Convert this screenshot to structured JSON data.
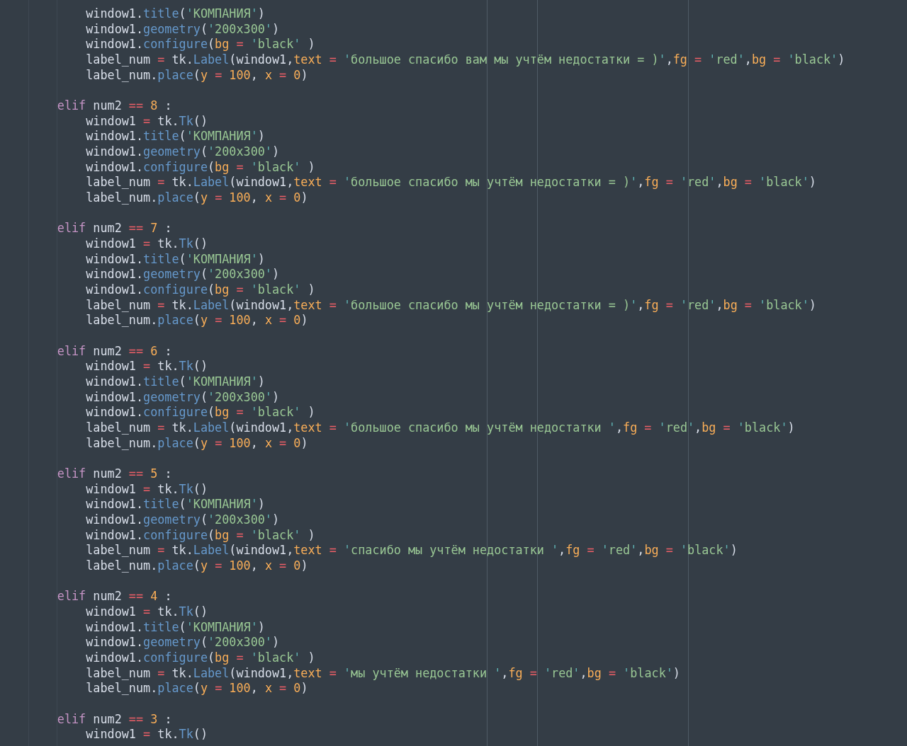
{
  "editor": {
    "blocks": [
      {
        "body": [
          [
            {
              "text": "window1.",
              "kind": "plain"
            },
            {
              "text": "title",
              "kind": "method"
            },
            {
              "text": "(",
              "kind": "plain"
            },
            {
              "text": "'КОМПАНИЯ'",
              "kind": "string"
            },
            {
              "text": ")",
              "kind": "plain"
            }
          ],
          [
            {
              "text": "window1.",
              "kind": "plain"
            },
            {
              "text": "geometry",
              "kind": "method"
            },
            {
              "text": "(",
              "kind": "plain"
            },
            {
              "text": "'200x300'",
              "kind": "string"
            },
            {
              "text": ")",
              "kind": "plain"
            }
          ],
          [
            {
              "text": "window1.",
              "kind": "plain"
            },
            {
              "text": "configure",
              "kind": "method"
            },
            {
              "text": "(",
              "kind": "plain"
            },
            {
              "text": "bg",
              "kind": "param"
            },
            {
              "text": " = ",
              "kind": "op"
            },
            {
              "text": "'black'",
              "kind": "string"
            },
            {
              "text": " )",
              "kind": "plain"
            }
          ],
          [
            {
              "text": "label_num",
              "kind": "plain"
            },
            {
              "text": " = ",
              "kind": "op"
            },
            {
              "text": "tk.",
              "kind": "plain"
            },
            {
              "text": "Label",
              "kind": "method"
            },
            {
              "text": "(window1,",
              "kind": "plain"
            },
            {
              "text": "text",
              "kind": "param"
            },
            {
              "text": " = ",
              "kind": "op"
            },
            {
              "text": "'большое спасибо вам мы учтём недостатки = )'",
              "kind": "string"
            },
            {
              "text": ",",
              "kind": "plain"
            },
            {
              "text": "fg",
              "kind": "param"
            },
            {
              "text": " = ",
              "kind": "op"
            },
            {
              "text": "'red'",
              "kind": "string"
            },
            {
              "text": ",",
              "kind": "plain"
            },
            {
              "text": "bg",
              "kind": "param"
            },
            {
              "text": " = ",
              "kind": "op"
            },
            {
              "text": "'black'",
              "kind": "string"
            },
            {
              "text": ")",
              "kind": "plain"
            }
          ],
          [
            {
              "text": "label_num.",
              "kind": "plain"
            },
            {
              "text": "place",
              "kind": "method"
            },
            {
              "text": "(",
              "kind": "plain"
            },
            {
              "text": "y",
              "kind": "param"
            },
            {
              "text": " = ",
              "kind": "op"
            },
            {
              "text": "100",
              "kind": "number"
            },
            {
              "text": ", ",
              "kind": "plain"
            },
            {
              "text": "x",
              "kind": "param"
            },
            {
              "text": " = ",
              "kind": "op"
            },
            {
              "text": "0",
              "kind": "number"
            },
            {
              "text": ")",
              "kind": "plain"
            }
          ]
        ]
      },
      {
        "header": [
          {
            "text": "elif",
            "kind": "keyword"
          },
          {
            "text": " num2 ",
            "kind": "plain"
          },
          {
            "text": "==",
            "kind": "op"
          },
          {
            "text": " 8",
            "kind": "number"
          },
          {
            "text": " :",
            "kind": "plain"
          }
        ],
        "body": [
          [
            {
              "text": "window1",
              "kind": "plain"
            },
            {
              "text": " = ",
              "kind": "op"
            },
            {
              "text": "tk.",
              "kind": "plain"
            },
            {
              "text": "Tk",
              "kind": "method"
            },
            {
              "text": "()",
              "kind": "plain"
            }
          ],
          [
            {
              "text": "window1.",
              "kind": "plain"
            },
            {
              "text": "title",
              "kind": "method"
            },
            {
              "text": "(",
              "kind": "plain"
            },
            {
              "text": "'КОМПАНИЯ'",
              "kind": "string"
            },
            {
              "text": ")",
              "kind": "plain"
            }
          ],
          [
            {
              "text": "window1.",
              "kind": "plain"
            },
            {
              "text": "geometry",
              "kind": "method"
            },
            {
              "text": "(",
              "kind": "plain"
            },
            {
              "text": "'200x300'",
              "kind": "string"
            },
            {
              "text": ")",
              "kind": "plain"
            }
          ],
          [
            {
              "text": "window1.",
              "kind": "plain"
            },
            {
              "text": "configure",
              "kind": "method"
            },
            {
              "text": "(",
              "kind": "plain"
            },
            {
              "text": "bg",
              "kind": "param"
            },
            {
              "text": " = ",
              "kind": "op"
            },
            {
              "text": "'black'",
              "kind": "string"
            },
            {
              "text": " )",
              "kind": "plain"
            }
          ],
          [
            {
              "text": "label_num",
              "kind": "plain"
            },
            {
              "text": " = ",
              "kind": "op"
            },
            {
              "text": "tk.",
              "kind": "plain"
            },
            {
              "text": "Label",
              "kind": "method"
            },
            {
              "text": "(window1,",
              "kind": "plain"
            },
            {
              "text": "text",
              "kind": "param"
            },
            {
              "text": " = ",
              "kind": "op"
            },
            {
              "text": "'большое спасибо мы учтём недостатки = )'",
              "kind": "string"
            },
            {
              "text": ",",
              "kind": "plain"
            },
            {
              "text": "fg",
              "kind": "param"
            },
            {
              "text": " = ",
              "kind": "op"
            },
            {
              "text": "'red'",
              "kind": "string"
            },
            {
              "text": ",",
              "kind": "plain"
            },
            {
              "text": "bg",
              "kind": "param"
            },
            {
              "text": " = ",
              "kind": "op"
            },
            {
              "text": "'black'",
              "kind": "string"
            },
            {
              "text": ")",
              "kind": "plain"
            }
          ],
          [
            {
              "text": "label_num.",
              "kind": "plain"
            },
            {
              "text": "place",
              "kind": "method"
            },
            {
              "text": "(",
              "kind": "plain"
            },
            {
              "text": "y",
              "kind": "param"
            },
            {
              "text": " = ",
              "kind": "op"
            },
            {
              "text": "100",
              "kind": "number"
            },
            {
              "text": ", ",
              "kind": "plain"
            },
            {
              "text": "x",
              "kind": "param"
            },
            {
              "text": " = ",
              "kind": "op"
            },
            {
              "text": "0",
              "kind": "number"
            },
            {
              "text": ")",
              "kind": "plain"
            }
          ]
        ]
      },
      {
        "header": [
          {
            "text": "elif",
            "kind": "keyword"
          },
          {
            "text": " num2 ",
            "kind": "plain"
          },
          {
            "text": "==",
            "kind": "op"
          },
          {
            "text": " 7",
            "kind": "number"
          },
          {
            "text": " :",
            "kind": "plain"
          }
        ],
        "body": [
          [
            {
              "text": "window1",
              "kind": "plain"
            },
            {
              "text": " = ",
              "kind": "op"
            },
            {
              "text": "tk.",
              "kind": "plain"
            },
            {
              "text": "Tk",
              "kind": "method"
            },
            {
              "text": "()",
              "kind": "plain"
            }
          ],
          [
            {
              "text": "window1.",
              "kind": "plain"
            },
            {
              "text": "title",
              "kind": "method"
            },
            {
              "text": "(",
              "kind": "plain"
            },
            {
              "text": "'КОМПАНИЯ'",
              "kind": "string"
            },
            {
              "text": ")",
              "kind": "plain"
            }
          ],
          [
            {
              "text": "window1.",
              "kind": "plain"
            },
            {
              "text": "geometry",
              "kind": "method"
            },
            {
              "text": "(",
              "kind": "plain"
            },
            {
              "text": "'200x300'",
              "kind": "string"
            },
            {
              "text": ")",
              "kind": "plain"
            }
          ],
          [
            {
              "text": "window1.",
              "kind": "plain"
            },
            {
              "text": "configure",
              "kind": "method"
            },
            {
              "text": "(",
              "kind": "plain"
            },
            {
              "text": "bg",
              "kind": "param"
            },
            {
              "text": " = ",
              "kind": "op"
            },
            {
              "text": "'black'",
              "kind": "string"
            },
            {
              "text": " )",
              "kind": "plain"
            }
          ],
          [
            {
              "text": "label_num",
              "kind": "plain"
            },
            {
              "text": " = ",
              "kind": "op"
            },
            {
              "text": "tk.",
              "kind": "plain"
            },
            {
              "text": "Label",
              "kind": "method"
            },
            {
              "text": "(window1,",
              "kind": "plain"
            },
            {
              "text": "text",
              "kind": "param"
            },
            {
              "text": " = ",
              "kind": "op"
            },
            {
              "text": "'большое спасибо мы учтём недостатки = )'",
              "kind": "string"
            },
            {
              "text": ",",
              "kind": "plain"
            },
            {
              "text": "fg",
              "kind": "param"
            },
            {
              "text": " = ",
              "kind": "op"
            },
            {
              "text": "'red'",
              "kind": "string"
            },
            {
              "text": ",",
              "kind": "plain"
            },
            {
              "text": "bg",
              "kind": "param"
            },
            {
              "text": " = ",
              "kind": "op"
            },
            {
              "text": "'black'",
              "kind": "string"
            },
            {
              "text": ")",
              "kind": "plain"
            }
          ],
          [
            {
              "text": "label_num.",
              "kind": "plain"
            },
            {
              "text": "place",
              "kind": "method"
            },
            {
              "text": "(",
              "kind": "plain"
            },
            {
              "text": "y",
              "kind": "param"
            },
            {
              "text": " = ",
              "kind": "op"
            },
            {
              "text": "100",
              "kind": "number"
            },
            {
              "text": ", ",
              "kind": "plain"
            },
            {
              "text": "x",
              "kind": "param"
            },
            {
              "text": " = ",
              "kind": "op"
            },
            {
              "text": "0",
              "kind": "number"
            },
            {
              "text": ")",
              "kind": "plain"
            }
          ]
        ]
      },
      {
        "header": [
          {
            "text": "elif",
            "kind": "keyword"
          },
          {
            "text": " num2 ",
            "kind": "plain"
          },
          {
            "text": "==",
            "kind": "op"
          },
          {
            "text": " 6",
            "kind": "number"
          },
          {
            "text": " :",
            "kind": "plain"
          }
        ],
        "body": [
          [
            {
              "text": "window1",
              "kind": "plain"
            },
            {
              "text": " = ",
              "kind": "op"
            },
            {
              "text": "tk.",
              "kind": "plain"
            },
            {
              "text": "Tk",
              "kind": "method"
            },
            {
              "text": "()",
              "kind": "plain"
            }
          ],
          [
            {
              "text": "window1.",
              "kind": "plain"
            },
            {
              "text": "title",
              "kind": "method"
            },
            {
              "text": "(",
              "kind": "plain"
            },
            {
              "text": "'КОМПАНИЯ'",
              "kind": "string"
            },
            {
              "text": ")",
              "kind": "plain"
            }
          ],
          [
            {
              "text": "window1.",
              "kind": "plain"
            },
            {
              "text": "geometry",
              "kind": "method"
            },
            {
              "text": "(",
              "kind": "plain"
            },
            {
              "text": "'200x300'",
              "kind": "string"
            },
            {
              "text": ")",
              "kind": "plain"
            }
          ],
          [
            {
              "text": "window1.",
              "kind": "plain"
            },
            {
              "text": "configure",
              "kind": "method"
            },
            {
              "text": "(",
              "kind": "plain"
            },
            {
              "text": "bg",
              "kind": "param"
            },
            {
              "text": " = ",
              "kind": "op"
            },
            {
              "text": "'black'",
              "kind": "string"
            },
            {
              "text": " )",
              "kind": "plain"
            }
          ],
          [
            {
              "text": "label_num",
              "kind": "plain"
            },
            {
              "text": " = ",
              "kind": "op"
            },
            {
              "text": "tk.",
              "kind": "plain"
            },
            {
              "text": "Label",
              "kind": "method"
            },
            {
              "text": "(window1,",
              "kind": "plain"
            },
            {
              "text": "text",
              "kind": "param"
            },
            {
              "text": " = ",
              "kind": "op"
            },
            {
              "text": "'большое спасибо мы учтём недостатки '",
              "kind": "string"
            },
            {
              "text": ",",
              "kind": "plain"
            },
            {
              "text": "fg",
              "kind": "param"
            },
            {
              "text": " = ",
              "kind": "op"
            },
            {
              "text": "'red'",
              "kind": "string"
            },
            {
              "text": ",",
              "kind": "plain"
            },
            {
              "text": "bg",
              "kind": "param"
            },
            {
              "text": " = ",
              "kind": "op"
            },
            {
              "text": "'black'",
              "kind": "string"
            },
            {
              "text": ")",
              "kind": "plain"
            }
          ],
          [
            {
              "text": "label_num.",
              "kind": "plain"
            },
            {
              "text": "place",
              "kind": "method"
            },
            {
              "text": "(",
              "kind": "plain"
            },
            {
              "text": "y",
              "kind": "param"
            },
            {
              "text": " = ",
              "kind": "op"
            },
            {
              "text": "100",
              "kind": "number"
            },
            {
              "text": ", ",
              "kind": "plain"
            },
            {
              "text": "x",
              "kind": "param"
            },
            {
              "text": " = ",
              "kind": "op"
            },
            {
              "text": "0",
              "kind": "number"
            },
            {
              "text": ")",
              "kind": "plain"
            }
          ]
        ]
      },
      {
        "header": [
          {
            "text": "elif",
            "kind": "keyword"
          },
          {
            "text": " num2 ",
            "kind": "plain"
          },
          {
            "text": "==",
            "kind": "op"
          },
          {
            "text": " 5",
            "kind": "number"
          },
          {
            "text": " :",
            "kind": "plain"
          }
        ],
        "body": [
          [
            {
              "text": "window1",
              "kind": "plain"
            },
            {
              "text": " = ",
              "kind": "op"
            },
            {
              "text": "tk.",
              "kind": "plain"
            },
            {
              "text": "Tk",
              "kind": "method"
            },
            {
              "text": "()",
              "kind": "plain"
            }
          ],
          [
            {
              "text": "window1.",
              "kind": "plain"
            },
            {
              "text": "title",
              "kind": "method"
            },
            {
              "text": "(",
              "kind": "plain"
            },
            {
              "text": "'КОМПАНИЯ'",
              "kind": "string"
            },
            {
              "text": ")",
              "kind": "plain"
            }
          ],
          [
            {
              "text": "window1.",
              "kind": "plain"
            },
            {
              "text": "geometry",
              "kind": "method"
            },
            {
              "text": "(",
              "kind": "plain"
            },
            {
              "text": "'200x300'",
              "kind": "string"
            },
            {
              "text": ")",
              "kind": "plain"
            }
          ],
          [
            {
              "text": "window1.",
              "kind": "plain"
            },
            {
              "text": "configure",
              "kind": "method"
            },
            {
              "text": "(",
              "kind": "plain"
            },
            {
              "text": "bg",
              "kind": "param"
            },
            {
              "text": " = ",
              "kind": "op"
            },
            {
              "text": "'black'",
              "kind": "string"
            },
            {
              "text": " )",
              "kind": "plain"
            }
          ],
          [
            {
              "text": "label_num",
              "kind": "plain"
            },
            {
              "text": " = ",
              "kind": "op"
            },
            {
              "text": "tk.",
              "kind": "plain"
            },
            {
              "text": "Label",
              "kind": "method"
            },
            {
              "text": "(window1,",
              "kind": "plain"
            },
            {
              "text": "text",
              "kind": "param"
            },
            {
              "text": " = ",
              "kind": "op"
            },
            {
              "text": "'спасибо мы учтём недостатки '",
              "kind": "string"
            },
            {
              "text": ",",
              "kind": "plain"
            },
            {
              "text": "fg",
              "kind": "param"
            },
            {
              "text": " = ",
              "kind": "op"
            },
            {
              "text": "'red'",
              "kind": "string"
            },
            {
              "text": ",",
              "kind": "plain"
            },
            {
              "text": "bg",
              "kind": "param"
            },
            {
              "text": " = ",
              "kind": "op"
            },
            {
              "text": "'black'",
              "kind": "string"
            },
            {
              "text": ")",
              "kind": "plain"
            }
          ],
          [
            {
              "text": "label_num.",
              "kind": "plain"
            },
            {
              "text": "place",
              "kind": "method"
            },
            {
              "text": "(",
              "kind": "plain"
            },
            {
              "text": "y",
              "kind": "param"
            },
            {
              "text": " = ",
              "kind": "op"
            },
            {
              "text": "100",
              "kind": "number"
            },
            {
              "text": ", ",
              "kind": "plain"
            },
            {
              "text": "x",
              "kind": "param"
            },
            {
              "text": " = ",
              "kind": "op"
            },
            {
              "text": "0",
              "kind": "number"
            },
            {
              "text": ")",
              "kind": "plain"
            }
          ]
        ]
      },
      {
        "header": [
          {
            "text": "elif",
            "kind": "keyword"
          },
          {
            "text": " num2 ",
            "kind": "plain"
          },
          {
            "text": "==",
            "kind": "op"
          },
          {
            "text": " 4",
            "kind": "number"
          },
          {
            "text": " :",
            "kind": "plain"
          }
        ],
        "body": [
          [
            {
              "text": "window1",
              "kind": "plain"
            },
            {
              "text": " = ",
              "kind": "op"
            },
            {
              "text": "tk.",
              "kind": "plain"
            },
            {
              "text": "Tk",
              "kind": "method"
            },
            {
              "text": "()",
              "kind": "plain"
            }
          ],
          [
            {
              "text": "window1.",
              "kind": "plain"
            },
            {
              "text": "title",
              "kind": "method"
            },
            {
              "text": "(",
              "kind": "plain"
            },
            {
              "text": "'КОМПАНИЯ'",
              "kind": "string"
            },
            {
              "text": ")",
              "kind": "plain"
            }
          ],
          [
            {
              "text": "window1.",
              "kind": "plain"
            },
            {
              "text": "geometry",
              "kind": "method"
            },
            {
              "text": "(",
              "kind": "plain"
            },
            {
              "text": "'200x300'",
              "kind": "string"
            },
            {
              "text": ")",
              "kind": "plain"
            }
          ],
          [
            {
              "text": "window1.",
              "kind": "plain"
            },
            {
              "text": "configure",
              "kind": "method"
            },
            {
              "text": "(",
              "kind": "plain"
            },
            {
              "text": "bg",
              "kind": "param"
            },
            {
              "text": " = ",
              "kind": "op"
            },
            {
              "text": "'black'",
              "kind": "string"
            },
            {
              "text": " )",
              "kind": "plain"
            }
          ],
          [
            {
              "text": "label_num",
              "kind": "plain"
            },
            {
              "text": " = ",
              "kind": "op"
            },
            {
              "text": "tk.",
              "kind": "plain"
            },
            {
              "text": "Label",
              "kind": "method"
            },
            {
              "text": "(window1,",
              "kind": "plain"
            },
            {
              "text": "text",
              "kind": "param"
            },
            {
              "text": " = ",
              "kind": "op"
            },
            {
              "text": "'мы учтём недостатки '",
              "kind": "string"
            },
            {
              "text": ",",
              "kind": "plain"
            },
            {
              "text": "fg",
              "kind": "param"
            },
            {
              "text": " = ",
              "kind": "op"
            },
            {
              "text": "'red'",
              "kind": "string"
            },
            {
              "text": ",",
              "kind": "plain"
            },
            {
              "text": "bg",
              "kind": "param"
            },
            {
              "text": " = ",
              "kind": "op"
            },
            {
              "text": "'black'",
              "kind": "string"
            },
            {
              "text": ")",
              "kind": "plain"
            }
          ],
          [
            {
              "text": "label_num.",
              "kind": "plain"
            },
            {
              "text": "place",
              "kind": "method"
            },
            {
              "text": "(",
              "kind": "plain"
            },
            {
              "text": "y",
              "kind": "param"
            },
            {
              "text": " = ",
              "kind": "op"
            },
            {
              "text": "100",
              "kind": "number"
            },
            {
              "text": ", ",
              "kind": "plain"
            },
            {
              "text": "x",
              "kind": "param"
            },
            {
              "text": " = ",
              "kind": "op"
            },
            {
              "text": "0",
              "kind": "number"
            },
            {
              "text": ")",
              "kind": "plain"
            }
          ]
        ]
      },
      {
        "header": [
          {
            "text": "elif",
            "kind": "keyword"
          },
          {
            "text": " num2 ",
            "kind": "plain"
          },
          {
            "text": "==",
            "kind": "op"
          },
          {
            "text": " 3",
            "kind": "number"
          },
          {
            "text": " :",
            "kind": "plain"
          }
        ],
        "body": [
          [
            {
              "text": "window1",
              "kind": "plain"
            },
            {
              "text": " = ",
              "kind": "op"
            },
            {
              "text": "tk.",
              "kind": "plain"
            },
            {
              "text": "Tk",
              "kind": "method"
            },
            {
              "text": "()",
              "kind": "plain"
            }
          ]
        ]
      }
    ]
  }
}
